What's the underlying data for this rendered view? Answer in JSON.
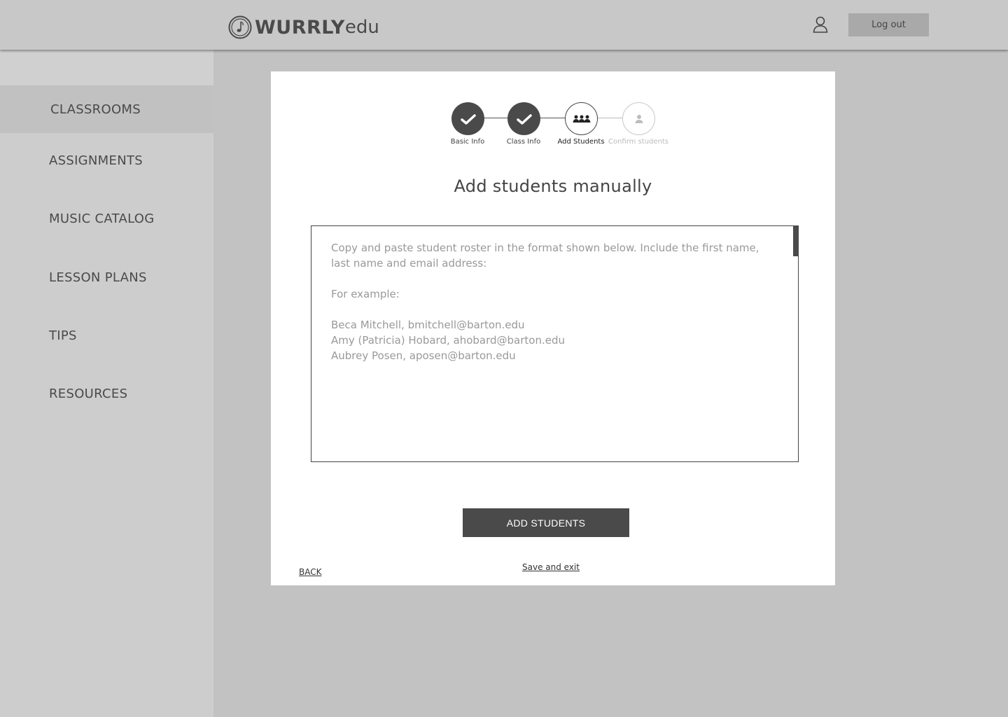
{
  "header": {
    "logo_main": "WURRLY",
    "logo_suffix": "edu",
    "logout_label": "Log out"
  },
  "sidebar": {
    "items": [
      {
        "label": "CLASSROOMS",
        "active": true
      },
      {
        "label": "ASSIGNMENTS",
        "active": false
      },
      {
        "label": "MUSIC CATALOG",
        "active": false
      },
      {
        "label": "LESSON PLANS",
        "active": false
      },
      {
        "label": "TIPS",
        "active": false
      },
      {
        "label": "RESOURCES",
        "active": false
      }
    ]
  },
  "stepper": {
    "steps": [
      {
        "label": "Basic Info",
        "state": "done",
        "icon": "check-icon"
      },
      {
        "label": "Class Info",
        "state": "done",
        "icon": "check-icon"
      },
      {
        "label": "Add Students",
        "state": "current",
        "icon": "group-icon"
      },
      {
        "label": "Confirm students",
        "state": "future",
        "icon": "person-icon"
      }
    ]
  },
  "main": {
    "title": "Add students manually",
    "roster_placeholder": "Copy and paste student roster in the format shown below. Include the first name, last name and email address:\n\nFor example:\n\nBeca Mitchell, bmitchell@barton.edu\nAmy (Patricia) Hobard, ahobard@barton.edu\nAubrey Posen, aposen@barton.edu",
    "add_button_label": "ADD STUDENTS",
    "save_exit_label": "Save and exit",
    "back_label": "BACK"
  },
  "colors": {
    "background": "#c2c2c2",
    "sidebar": "#cdcdcd",
    "primary_dark": "#4a4a4a",
    "logout_bg": "#a9a9a9"
  }
}
